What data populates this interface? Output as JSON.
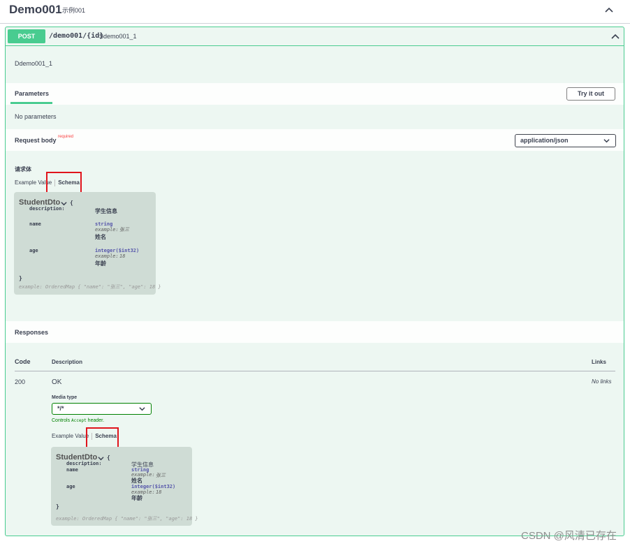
{
  "tag": {
    "name": "Demo001",
    "description": "示例001"
  },
  "operation": {
    "method": "POST",
    "path": "/demo001/{id}",
    "summary": "Sdemo001_1",
    "description": "Ddemo001_1"
  },
  "parameters": {
    "tab_label": "Parameters",
    "try_button": "Try it out",
    "empty_text": "No parameters"
  },
  "request_body": {
    "title": "Request body",
    "required_label": "required",
    "content_type": "application/json",
    "body_label": "请求体",
    "tab_example": "Example Value",
    "tab_schema": "Schema"
  },
  "schema": {
    "model_name": "StudentDto",
    "toggle_icon": "chevron-down-icon",
    "open_brace": "{",
    "close_brace": "}",
    "description_key": "description:",
    "description_value": "学生信息",
    "fields": [
      {
        "name": "name",
        "type": "string",
        "example_label": "example:",
        "example_value": "张三",
        "description": "姓名"
      },
      {
        "name": "age",
        "type": "integer($int32)",
        "example_label": "example:",
        "example_value": "18",
        "description": "年龄"
      }
    ],
    "example_line": "example: OrderedMap { \"name\": \"张三\", \"age\": 18 }"
  },
  "responses": {
    "title": "Responses",
    "col_code": "Code",
    "col_description": "Description",
    "col_links": "Links",
    "code": "200",
    "description": "OK",
    "links": "No links",
    "media_type_label": "Media type",
    "media_type_value": "*/*",
    "controls_prefix": "Controls",
    "controls_code": "Accept",
    "controls_suffix": "header.",
    "tab_example": "Example Value",
    "tab_schema": "Schema"
  },
  "colors": {
    "post": "#49cc90",
    "highlight": "#e0141c",
    "opblock_bg": "#edf7f2"
  },
  "watermark": "CSDN @风清已存在"
}
